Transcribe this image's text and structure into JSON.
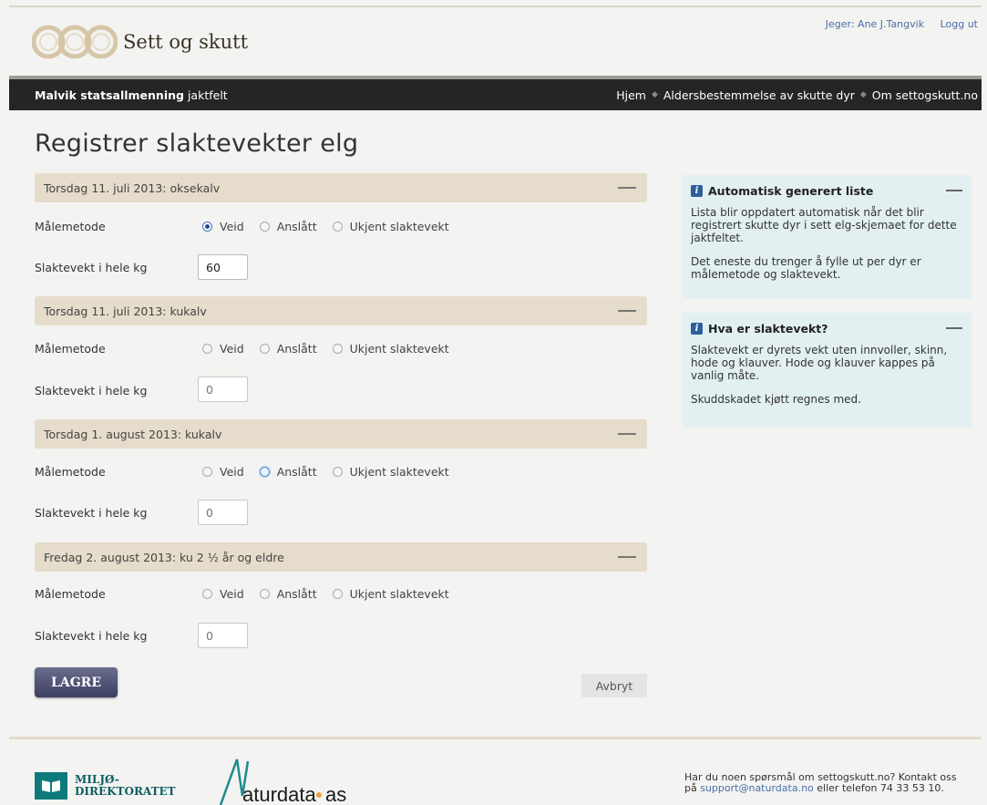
{
  "header": {
    "site_name": "Sett og skutt",
    "user_label": "Jeger: Ane J.Tangvik",
    "logout": "Logg ut"
  },
  "navbar": {
    "area_name": "Malvik statsallmenning",
    "area_sub": "jaktfelt",
    "links": [
      "Hjem",
      "Aldersbestemmelse av skutte dyr",
      "Om settogskutt.no"
    ]
  },
  "page": {
    "title": "Registrer slaktevekter elg"
  },
  "form": {
    "method_label": "Målemetode",
    "weight_label": "Slaktevekt i hele kg",
    "options": [
      "Veid",
      "Anslått",
      "Ukjent slaktevekt"
    ],
    "entries": [
      {
        "heading": "Torsdag 11. juli 2013: oksekalv",
        "selected": "Veid",
        "weight": "60",
        "placeholder": ""
      },
      {
        "heading": "Torsdag 11. juli 2013: kukalv",
        "selected": "",
        "weight": "",
        "placeholder": "0"
      },
      {
        "heading": "Torsdag 1. august 2013: kukalv",
        "selected": "",
        "weight": "",
        "placeholder": "0"
      },
      {
        "heading": "Fredag 2. august 2013: ku 2 ½ år og eldre",
        "selected": "",
        "weight": "",
        "placeholder": "0"
      }
    ],
    "save_label": "LAGRE",
    "cancel_label": "Avbryt"
  },
  "sidebar": {
    "boxes": [
      {
        "title": "Automatisk generert liste",
        "paragraphs": [
          "Lista blir oppdatert automatisk når det blir registrert skutte dyr i sett elg-skjemaet for dette jaktfeltet.",
          "Det eneste du trenger å fylle ut per dyr er målemetode og slaktevekt."
        ]
      },
      {
        "title": "Hva er slaktevekt?",
        "paragraphs": [
          "Slaktevekt er dyrets vekt uten innvoller, skinn, hode og klauver. Hode og klauver kappes på vanlig måte.",
          "Skuddskadet kjøtt regnes med."
        ]
      }
    ]
  },
  "footer": {
    "md_line1": "MILJØ-",
    "md_line2": "DIREKTORATET",
    "nd_name": "aturdata",
    "nd_suffix": "as",
    "contact_line1": "Har du noen spørsmål om settogskutt.no? Kontakt oss",
    "contact_pre": "på ",
    "contact_email": "support@naturdata.no",
    "contact_post": " eller telefon 74 33 53 10."
  },
  "colors": {
    "navbar": "#252525",
    "section_bar": "#e5dccb",
    "info_box": "#e3f0f2",
    "save_button": "#4a4d6e",
    "link": "#4a6ea8"
  }
}
